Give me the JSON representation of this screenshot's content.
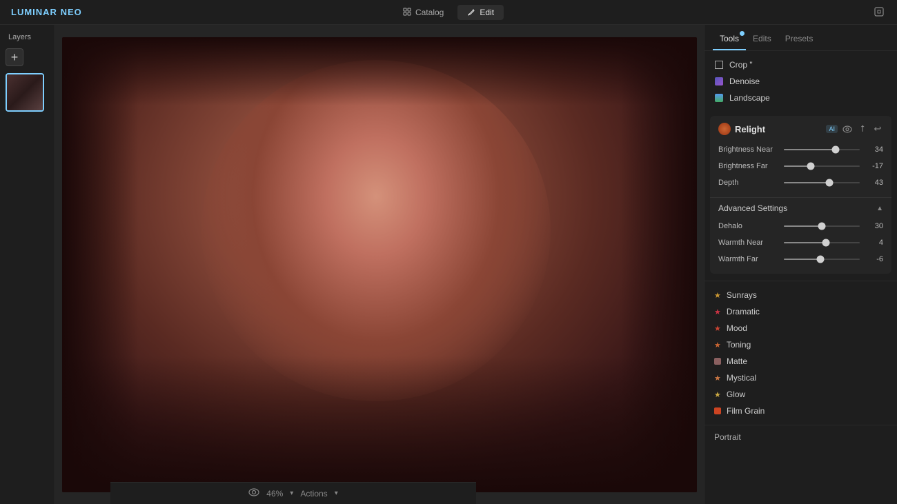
{
  "topbar": {
    "logo": "LUMINAR",
    "logo_accent": "NEO",
    "nav": [
      {
        "label": "Catalog",
        "icon": "grid",
        "active": false
      },
      {
        "label": "Edit",
        "icon": "edit",
        "active": true
      }
    ],
    "window_icon": "share"
  },
  "left_panel": {
    "title": "Layers",
    "add_label": "+"
  },
  "canvas": {
    "zoom": "46%",
    "actions_label": "Actions"
  },
  "right_panel": {
    "tabs": [
      {
        "label": "Tools",
        "active": true,
        "badge": true
      },
      {
        "label": "Edits",
        "active": false,
        "badge": false
      },
      {
        "label": "Presets",
        "active": false,
        "badge": false
      }
    ],
    "tools": [
      {
        "label": "Crop \"",
        "icon": "crop"
      },
      {
        "label": "Denoise",
        "icon": "denoise"
      },
      {
        "label": "Landscape",
        "icon": "landscape"
      }
    ],
    "relight": {
      "title": "Relight",
      "ai_badge": "AI",
      "sliders": [
        {
          "label": "Brightness Near",
          "value": 34,
          "percent": 68
        },
        {
          "label": "Brightness Far",
          "value": -17,
          "percent": 35
        },
        {
          "label": "Depth",
          "value": 43,
          "percent": 60
        }
      ],
      "advanced_settings": {
        "label": "Advanced Settings",
        "sliders": [
          {
            "label": "Dehalo",
            "value": 30,
            "percent": 50
          },
          {
            "label": "Warmth Near",
            "value": 4,
            "percent": 55
          },
          {
            "label": "Warmth Far",
            "value": -6,
            "percent": 48
          }
        ]
      }
    },
    "filter_list": [
      {
        "label": "Sunrays",
        "icon": "star",
        "color": "#cc9933"
      },
      {
        "label": "Dramatic",
        "icon": "star",
        "color": "#cc3344"
      },
      {
        "label": "Mood",
        "icon": "star",
        "color": "#cc4433"
      },
      {
        "label": "Toning",
        "icon": "star",
        "color": "#cc6633"
      },
      {
        "label": "Matte",
        "icon": "box",
        "color": "#8a6060"
      },
      {
        "label": "Mystical",
        "icon": "star",
        "color": "#cc7744"
      },
      {
        "label": "Glow",
        "icon": "star",
        "color": "#ccaa44"
      },
      {
        "label": "Film Grain",
        "icon": "box",
        "color": "#cc4422"
      }
    ],
    "portrait_section": {
      "label": "Portrait"
    }
  }
}
